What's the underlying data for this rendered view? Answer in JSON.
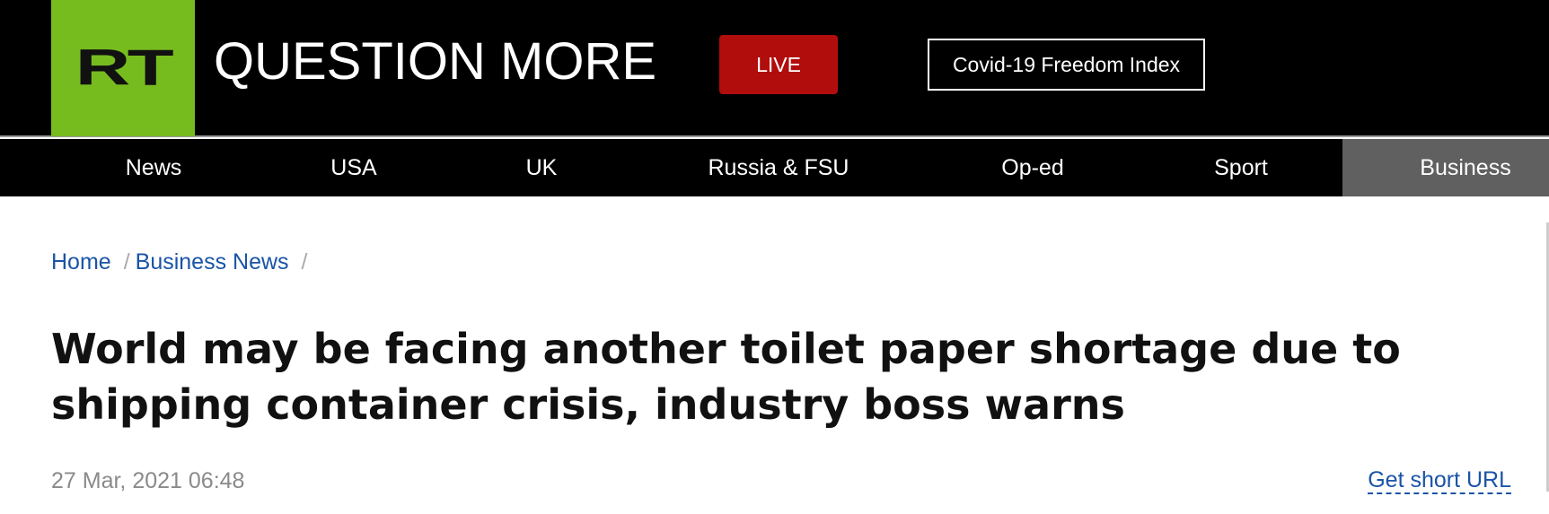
{
  "header": {
    "logo_text": "RT",
    "tagline": "QUESTION MORE",
    "live_label": "LIVE",
    "covid_label": "Covid-19 Freedom Index"
  },
  "nav": {
    "items": [
      {
        "label": "News"
      },
      {
        "label": "USA"
      },
      {
        "label": "UK"
      },
      {
        "label": "Russia & FSU"
      },
      {
        "label": "Op-ed"
      },
      {
        "label": "Sport"
      },
      {
        "label": "Business",
        "active": true
      }
    ]
  },
  "breadcrumb": {
    "items": [
      {
        "label": "Home"
      },
      {
        "label": "Business News"
      }
    ],
    "separator": "/"
  },
  "article": {
    "title": "World may be facing another toilet paper shortage due to shipping container crisis, industry boss warns",
    "timestamp": "27 Mar, 2021 06:48",
    "short_url_label": "Get short URL"
  },
  "colors": {
    "brand_green": "#77bc1f",
    "live_red": "#b10d0d",
    "link_blue": "#1a54a6",
    "nav_active": "#606060"
  }
}
